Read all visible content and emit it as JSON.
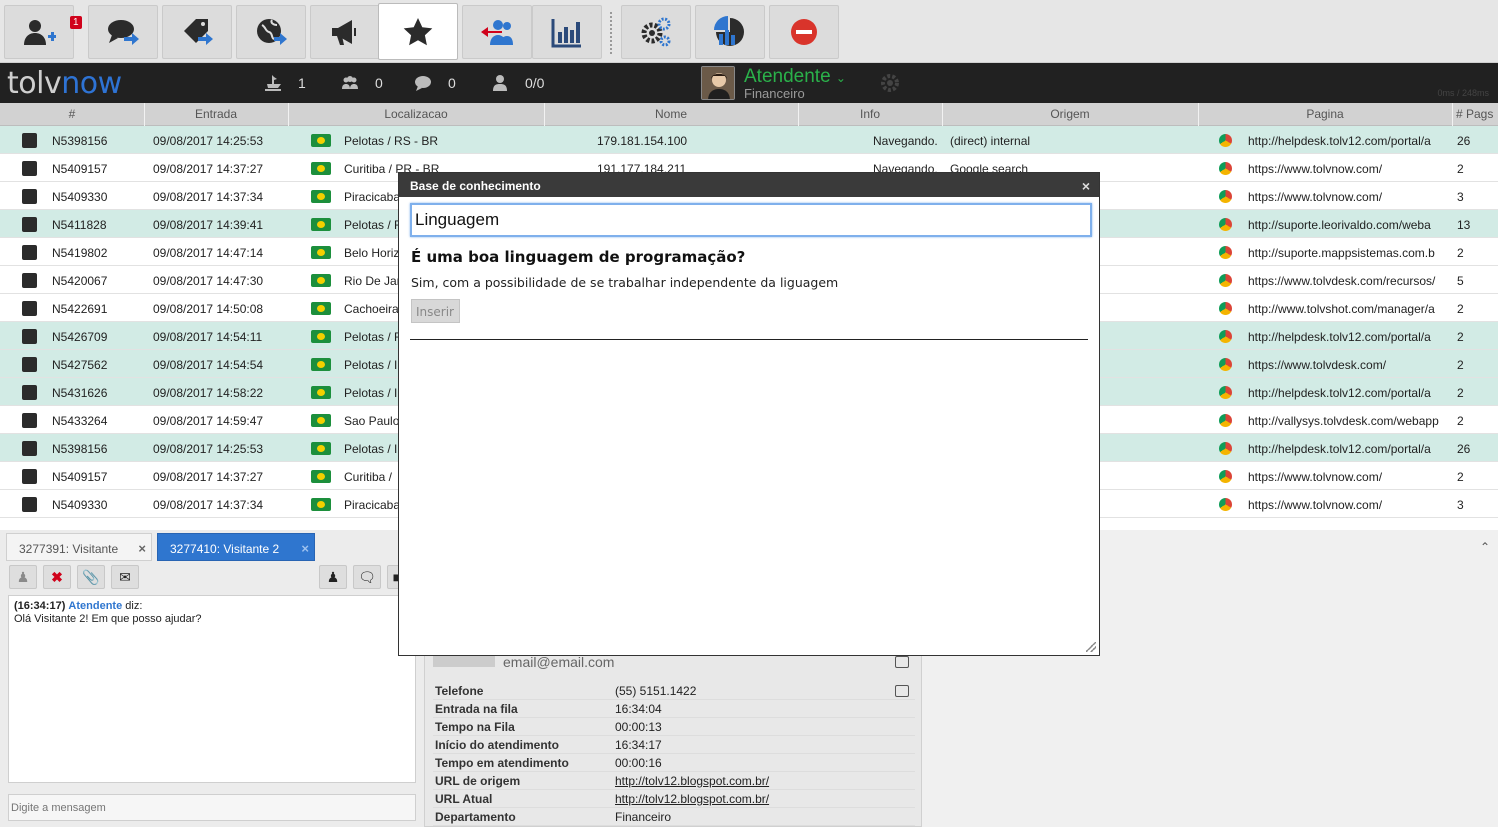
{
  "toolbar": {
    "badge_count": "1",
    "buttons": [
      {
        "icon": "user-plus-icon"
      },
      {
        "icon": "chat-transfer-icon"
      },
      {
        "icon": "tags-transfer-icon"
      },
      {
        "icon": "globe-transfer-icon"
      },
      {
        "icon": "megaphone-icon"
      },
      {
        "icon": "star-icon",
        "active": true
      },
      {
        "icon": "users-arrow-icon"
      },
      {
        "icon": "bar-chart-icon"
      },
      {
        "icon": "gears-icon"
      },
      {
        "icon": "reports-icon"
      },
      {
        "icon": "stop-icon"
      }
    ]
  },
  "header": {
    "logo_prefix": "tolv",
    "logo_suffix": "now",
    "stats": {
      "ships": "1",
      "groups": "0",
      "chats": "0",
      "users": "0/0"
    },
    "agent_name": "Atendente",
    "agent_dept": "Financeiro",
    "perf": "0ms / 248ms"
  },
  "columns": [
    "#",
    "Entrada",
    "Localizacao",
    "Nome",
    "Info",
    "Origem",
    "Pagina",
    "# Pags"
  ],
  "rows": [
    {
      "id": "N5398156",
      "entrada": "09/08/2017 14:25:53",
      "local": "Pelotas / RS - BR",
      "nome": "179.181.154.100",
      "info": "Navegando.",
      "origem": "(direct) internal",
      "pagina": "http://helpdesk.tolv12.com/portal/a",
      "pags": "26",
      "hl": true
    },
    {
      "id": "N5409157",
      "entrada": "09/08/2017 14:37:27",
      "local": "Curitiba / PR - BR",
      "nome": "191.177.184.211",
      "info": "Navegando.",
      "origem": "Google search",
      "pagina": "https://www.tolvnow.com/",
      "pags": "2",
      "hl": false
    },
    {
      "id": "N5409330",
      "entrada": "09/08/2017 14:37:34",
      "local": "Piracicaba",
      "nome": "",
      "info": "",
      "origem": "",
      "pagina": "https://www.tolvnow.com/",
      "pags": "3",
      "hl": false
    },
    {
      "id": "N5411828",
      "entrada": "09/08/2017 14:39:41",
      "local": "Pelotas / R",
      "nome": "",
      "info": "",
      "origem": "",
      "pagina": "http://suporte.leorivaldo.com/weba",
      "pags": "13",
      "hl": true
    },
    {
      "id": "N5419802",
      "entrada": "09/08/2017 14:47:14",
      "local": "Belo Horiz",
      "nome": "",
      "info": "",
      "origem": "",
      "pagina": "http://suporte.mappsistemas.com.b",
      "pags": "2",
      "hl": false
    },
    {
      "id": "N5420067",
      "entrada": "09/08/2017 14:47:30",
      "local": "Rio De Jan",
      "nome": "",
      "info": "",
      "origem": "",
      "pagina": "https://www.tolvdesk.com/recursos/",
      "pags": "5",
      "hl": false
    },
    {
      "id": "N5422691",
      "entrada": "09/08/2017 14:50:08",
      "local": "Cachoeira",
      "nome": "",
      "info": "",
      "origem": "",
      "pagina": "http://www.tolvshot.com/manager/a",
      "pags": "2",
      "hl": false
    },
    {
      "id": "N5426709",
      "entrada": "09/08/2017 14:54:11",
      "local": "Pelotas / R",
      "nome": "",
      "info": "",
      "origem": "",
      "pagina": "http://helpdesk.tolv12.com/portal/a",
      "pags": "2",
      "hl": true
    },
    {
      "id": "N5427562",
      "entrada": "09/08/2017 14:54:54",
      "local": "Pelotas / I",
      "nome": "",
      "info": "",
      "origem": "",
      "pagina": "https://www.tolvdesk.com/",
      "pags": "2",
      "hl": true
    },
    {
      "id": "N5431626",
      "entrada": "09/08/2017 14:58:22",
      "local": "Pelotas / I",
      "nome": "",
      "info": "",
      "origem": "",
      "pagina": "http://helpdesk.tolv12.com/portal/a",
      "pags": "2",
      "hl": true
    },
    {
      "id": "N5433264",
      "entrada": "09/08/2017 14:59:47",
      "local": "Sao Paulo",
      "nome": "",
      "info": "",
      "origem": "",
      "pagina": "http://vallysys.tolvdesk.com/webapp",
      "pags": "2",
      "hl": false
    },
    {
      "id": "N5398156",
      "entrada": "09/08/2017 14:25:53",
      "local": "Pelotas / I",
      "nome": "",
      "info": "",
      "origem": "",
      "pagina": "http://helpdesk.tolv12.com/portal/a",
      "pags": "26",
      "hl": true
    },
    {
      "id": "N5409157",
      "entrada": "09/08/2017 14:37:27",
      "local": "Curitiba /",
      "nome": "",
      "info": "",
      "origem": "",
      "pagina": "https://www.tolvnow.com/",
      "pags": "2",
      "hl": false
    },
    {
      "id": "N5409330",
      "entrada": "09/08/2017 14:37:34",
      "local": "Piracicaba",
      "nome": "",
      "info": "",
      "origem": "",
      "pagina": "https://www.tolvnow.com/",
      "pags": "3",
      "hl": false
    }
  ],
  "chat": {
    "tabs": [
      {
        "label": "3277391: Visitante",
        "close": "×"
      },
      {
        "label": "3277410: Visitante 2",
        "close": "×"
      }
    ],
    "log": {
      "time": "(16:34:17)",
      "author": "Atendente",
      "verb": "diz:",
      "message": "Olá Visitante 2! Em que posso ajudar?"
    },
    "input_placeholder": "Digite a mensagem"
  },
  "visitor_info": {
    "email": "email@email.com",
    "fields": [
      {
        "label": "Telefone",
        "value": "(55) 5151.1422"
      },
      {
        "label": "Entrada na fila",
        "value": "16:34:04"
      },
      {
        "label": "Tempo na Fila",
        "value": "00:00:13"
      },
      {
        "label": "Início do atendimento",
        "value": "16:34:17"
      },
      {
        "label": "Tempo em atendimento",
        "value": "00:00:16"
      },
      {
        "label": "URL de origem",
        "value": "http://tolv12.blogspot.com.br/"
      },
      {
        "label": "URL Atual",
        "value": "http://tolv12.blogspot.com.br/"
      },
      {
        "label": "Departamento",
        "value": "Financeiro"
      }
    ]
  },
  "modal": {
    "title": "Base de conhecimento",
    "close": "×",
    "search_value": "Linguagem",
    "result_title": "É uma boa linguagem de programação?",
    "result_answer": "Sim, com a possibilidade de se trabalhar independente da liguagem",
    "insert_label": "Inserir"
  }
}
